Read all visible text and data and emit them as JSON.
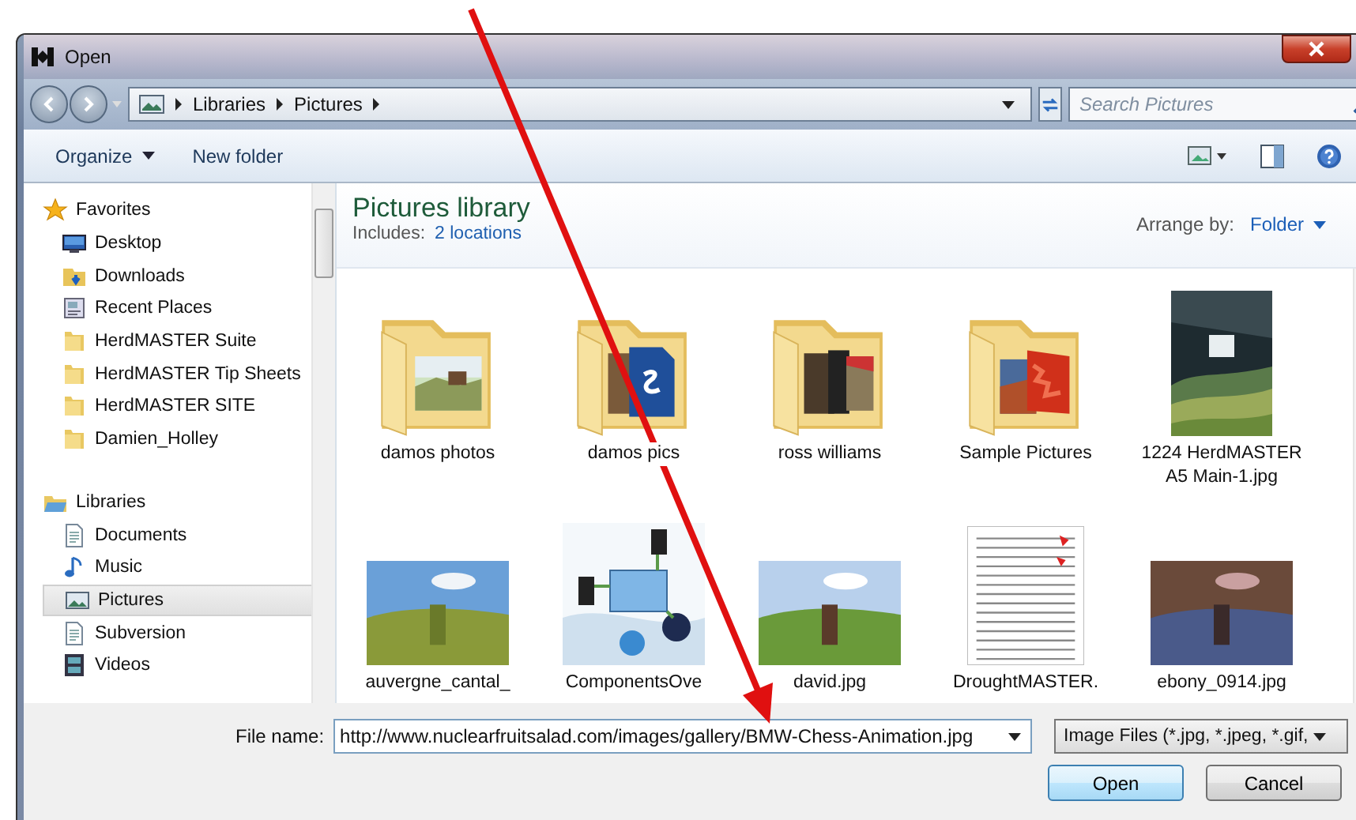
{
  "window": {
    "title": "Open"
  },
  "address": {
    "crumbs": [
      "Libraries",
      "Pictures"
    ]
  },
  "search": {
    "placeholder": "Search Pictures"
  },
  "toolbar": {
    "organize": "Organize",
    "new_folder": "New folder"
  },
  "nav": [
    {
      "label": "Favorites",
      "kind": "star",
      "selected": false,
      "children": [
        {
          "label": "Desktop",
          "kind": "desktop",
          "selected": false
        },
        {
          "label": "Downloads",
          "kind": "download",
          "selected": false
        },
        {
          "label": "Recent Places",
          "kind": "recent",
          "selected": false
        },
        {
          "label": "HerdMASTER Suite",
          "kind": "folder",
          "selected": false
        },
        {
          "label": "HerdMASTER Tip Sheets",
          "kind": "folder",
          "selected": false
        },
        {
          "label": "HerdMASTER SITE",
          "kind": "folder",
          "selected": false
        },
        {
          "label": "Damien_Holley",
          "kind": "folder",
          "selected": false
        }
      ]
    },
    {
      "label": "Libraries",
      "kind": "library",
      "selected": false,
      "children": [
        {
          "label": "Documents",
          "kind": "document",
          "selected": false
        },
        {
          "label": "Music",
          "kind": "music",
          "selected": false
        },
        {
          "label": "Pictures",
          "kind": "pictures",
          "selected": true
        },
        {
          "label": "Subversion",
          "kind": "document",
          "selected": false
        },
        {
          "label": "Videos",
          "kind": "video",
          "selected": false
        }
      ]
    }
  ],
  "library": {
    "title": "Pictures library",
    "includes_label": "Includes:",
    "includes_link": "2 locations",
    "arrange_label": "Arrange by:",
    "arrange_value": "Folder"
  },
  "files": [
    {
      "name": "damos photos",
      "kind": "folder"
    },
    {
      "name": "damos pics",
      "kind": "folder"
    },
    {
      "name": "ross williams",
      "kind": "folder"
    },
    {
      "name": "Sample Pictures",
      "kind": "folder"
    },
    {
      "name": "1224 HerdMASTER A5 Main-1.jpg",
      "kind": "poster"
    },
    {
      "name": "auvergne_cantal_"
    },
    {
      "name": "ComponentsOve",
      "kind": "diagram"
    },
    {
      "name": "david.jpg"
    },
    {
      "name": "DroughtMASTER.",
      "kind": "sheet"
    },
    {
      "name": "ebony_0914.jpg"
    }
  ],
  "file_name": {
    "label": "File name:",
    "value": "http://www.nuclearfruitsalad.com/images/gallery/BMW-Chess-Animation.jpg"
  },
  "file_type": {
    "value": "Image Files (*.jpg, *.jpeg, *.gif,"
  },
  "buttons": [
    {
      "label": "Open",
      "default": true
    },
    {
      "label": "Cancel",
      "default": false
    }
  ]
}
